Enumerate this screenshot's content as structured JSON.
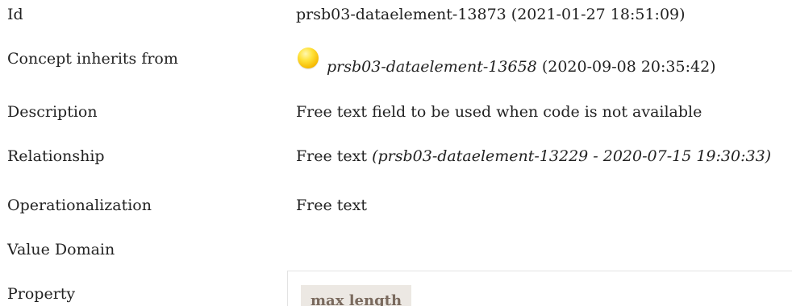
{
  "rows": {
    "id": {
      "label": "Id",
      "value": "prsb03-dataelement-13873 (2021-01-27 18:51:09)"
    },
    "concept_inherits": {
      "label": "Concept inherits from",
      "link": "prsb03-dataelement-13658",
      "timestamp": "(2020-09-08 20:35:42)",
      "status_icon": "yellow-status-dot-icon"
    },
    "description": {
      "label": "Description",
      "value": "Free text field to be used when code is not available"
    },
    "relationship": {
      "label": "Relationship",
      "value": "Free text",
      "ref": "(prsb03-dataelement-13229 - 2020-07-15 19:30:33)"
    },
    "operationalization": {
      "label": "Operationalization",
      "value": "Free text"
    },
    "value_domain": {
      "label": "Value Domain"
    },
    "property": {
      "label": "Property",
      "chip": "max length"
    }
  },
  "colors": {
    "text": "#222222",
    "status_dot": "#ffd21f",
    "chip_bg": "#ece8e3",
    "chip_text": "#7a6a5e"
  }
}
